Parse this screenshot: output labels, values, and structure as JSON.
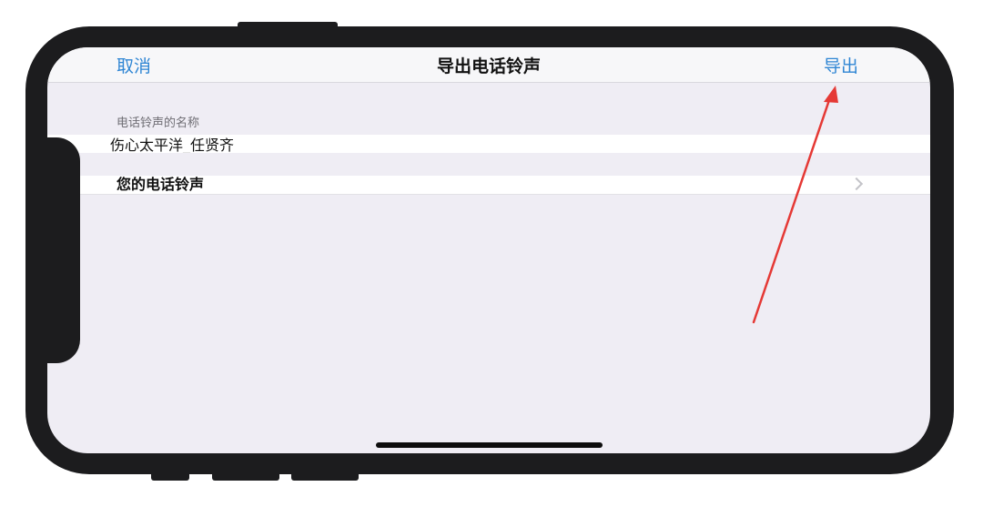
{
  "navbar": {
    "cancel_label": "取消",
    "title": "导出电话铃声",
    "export_label": "导出"
  },
  "form": {
    "name_header": "电话铃声的名称",
    "name_value": "伤心太平洋_任贤齐",
    "ringtone_row_label": "您的电话铃声"
  },
  "colors": {
    "accent": "#2f86d4",
    "annotation_arrow": "#e53935",
    "screen_background": "#efedf4"
  },
  "icons": {
    "row_disclosure": "chevron-right-icon"
  }
}
